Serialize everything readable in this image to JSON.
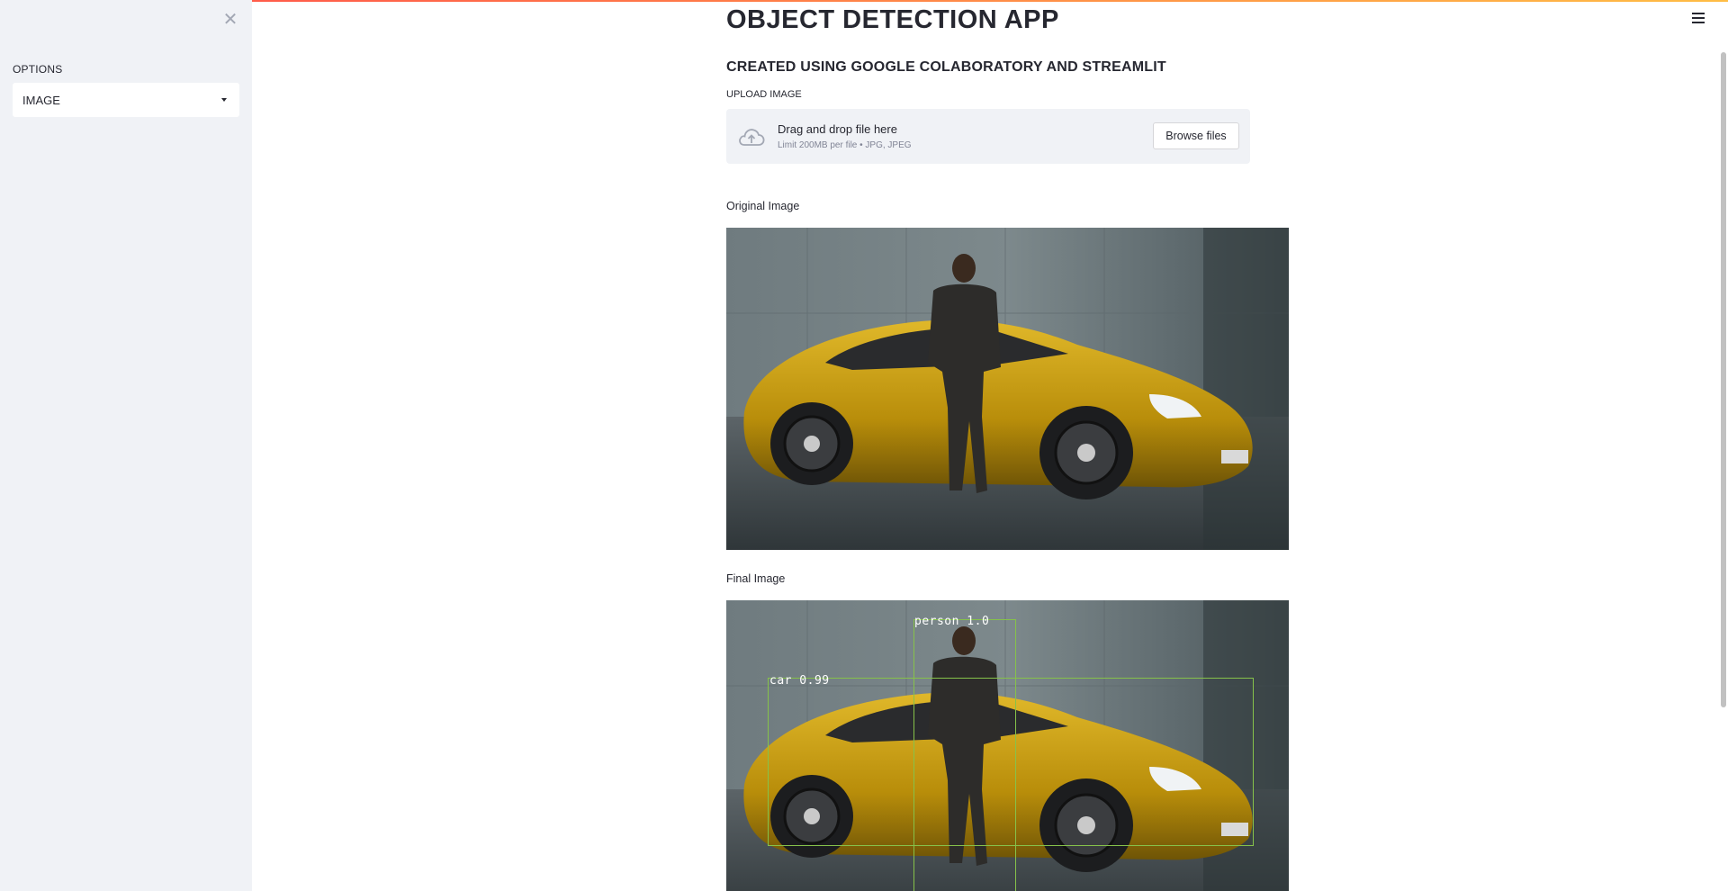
{
  "app": {
    "title": "OBJECT DETECTION APP",
    "subtitle": "CREATED USING GOOGLE COLABORATORY AND STREAMLIT"
  },
  "sidebar": {
    "close_icon": "close-icon",
    "options_label": "OPTIONS",
    "select_value": "IMAGE"
  },
  "uploader": {
    "label": "UPLOAD IMAGE",
    "drop_text": "Drag and drop file here",
    "limit_text": "Limit 200MB per file • JPG, JPEG",
    "browse_label": "Browse files",
    "icon": "cloud-upload-icon"
  },
  "original": {
    "caption": "Original Image"
  },
  "final": {
    "caption": "Final Image",
    "detections": [
      {
        "label": "person 1.0"
      },
      {
        "label": "car 0.99"
      }
    ]
  },
  "colors": {
    "sidebar_bg": "#f0f2f6",
    "text": "#262730",
    "box_green": "#86c24a",
    "car_yellow": "#c9a10f"
  }
}
